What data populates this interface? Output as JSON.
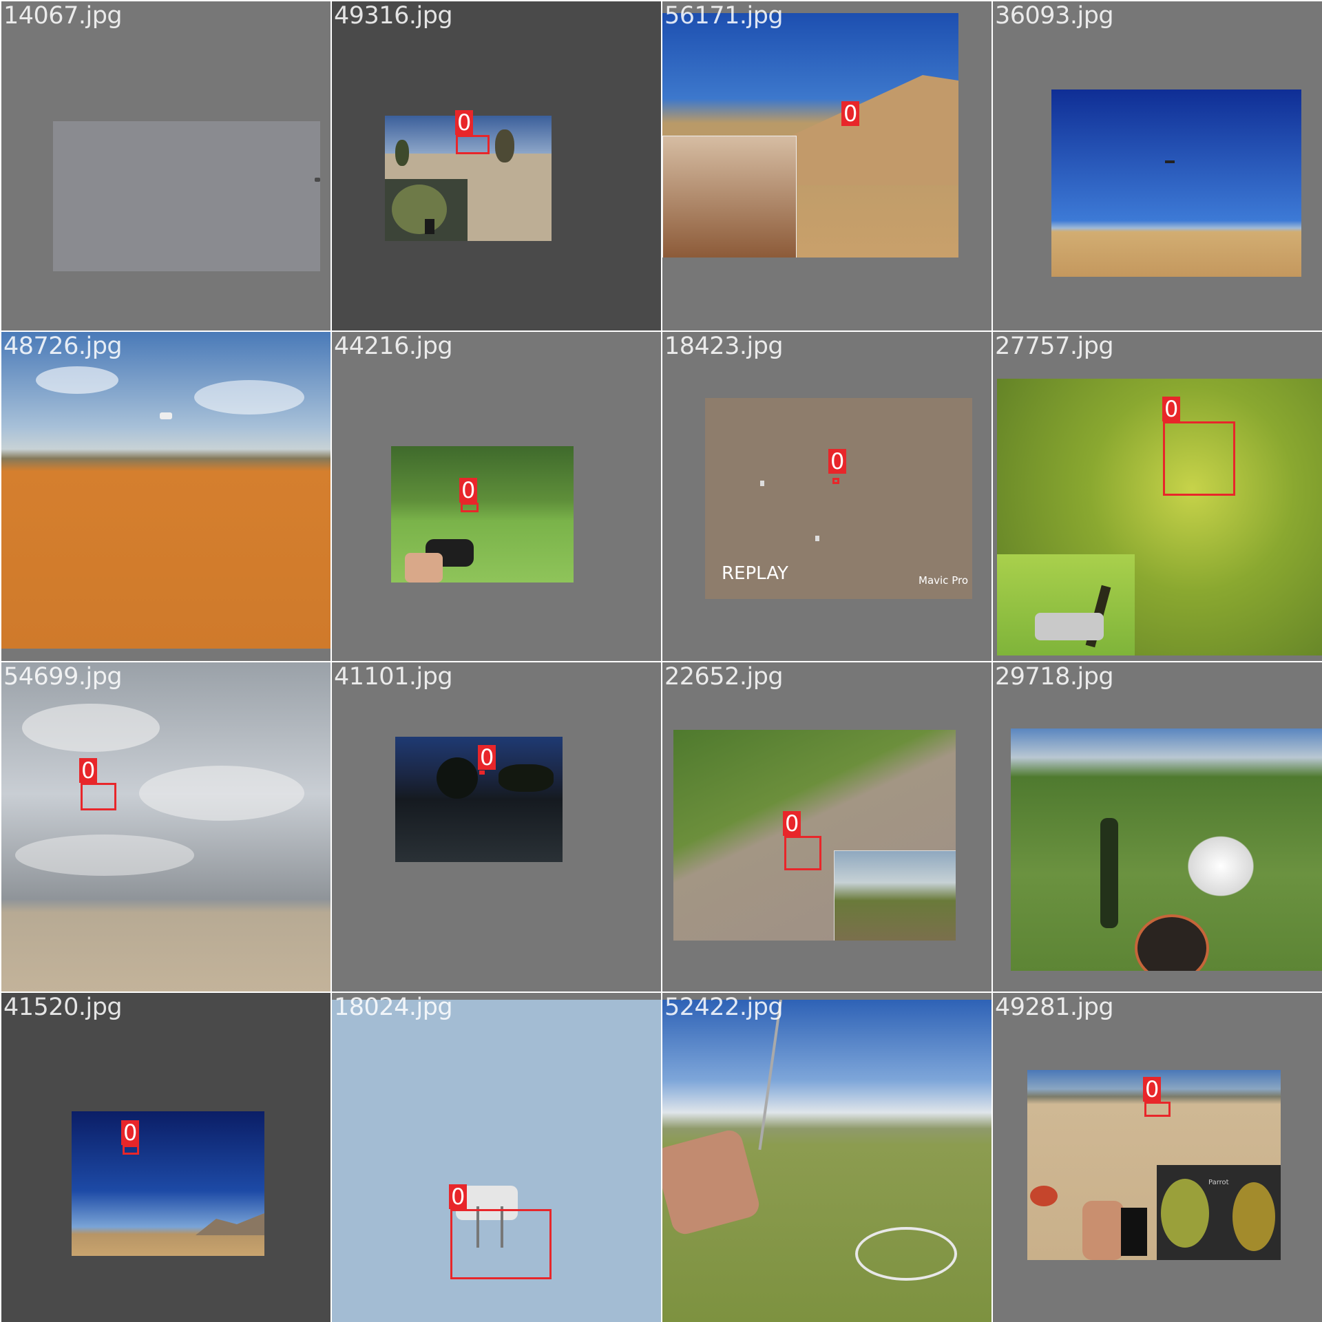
{
  "tiles": [
    {
      "filename": "14067.jpg",
      "label": ""
    },
    {
      "filename": "49316.jpg",
      "label": "0"
    },
    {
      "filename": "56171.jpg",
      "label": "0"
    },
    {
      "filename": "36093.jpg",
      "label": ""
    },
    {
      "filename": "48726.jpg",
      "label": ""
    },
    {
      "filename": "44216.jpg",
      "label": "0"
    },
    {
      "filename": "18423.jpg",
      "label": "0",
      "overlay_left": "REPLAY",
      "overlay_right": "Mavic Pro"
    },
    {
      "filename": "27757.jpg",
      "label": "0"
    },
    {
      "filename": "54699.jpg",
      "label": "0"
    },
    {
      "filename": "41101.jpg",
      "label": "0"
    },
    {
      "filename": "22652.jpg",
      "label": "0"
    },
    {
      "filename": "29718.jpg",
      "label": ""
    },
    {
      "filename": "41520.jpg",
      "label": "0"
    },
    {
      "filename": "18024.jpg",
      "label": "0"
    },
    {
      "filename": "52422.jpg",
      "label": ""
    },
    {
      "filename": "49281.jpg",
      "label": "0",
      "overlay_app": "Parrot"
    }
  ]
}
